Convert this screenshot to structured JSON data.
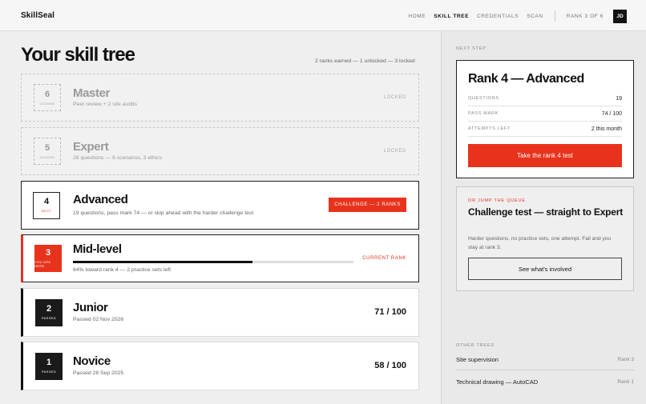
{
  "app": {
    "brand": "SkillSeal"
  },
  "nav": {
    "items": [
      {
        "label": "HOME",
        "active": false
      },
      {
        "label": "SKILL TREE",
        "active": true
      },
      {
        "label": "CREDENTIALS",
        "active": false
      },
      {
        "label": "SCAN",
        "active": false
      }
    ],
    "rank": "RANK 3 OF 6",
    "avatar": "JD"
  },
  "main": {
    "title": "Your skill tree",
    "summary": "2 ranks earned — 1 unlocked — 3 locked",
    "tiers": [
      {
        "number": "6",
        "status": "LOCKED",
        "name": "Master",
        "desc": "Peer review + 2 site audits",
        "tag": "LOCKED"
      },
      {
        "number": "5",
        "status": "LOCKED",
        "name": "Expert",
        "desc": "28 questions — 6 scenarios, 3 ethics",
        "tag": "LOCKED"
      },
      {
        "number": "4",
        "status": "NEXT",
        "name": "Advanced",
        "desc": "19 questions, pass mark 74 — or skip ahead with the harder challenge test",
        "action": "CHALLENGE — 2 RANKS"
      },
      {
        "number": "3",
        "status": "YOU ARE HERE",
        "name": "Mid-level",
        "desc": "64% toward rank 4 — 2 practice sets left",
        "tag": "CURRENT RANK",
        "progress": 0.64
      },
      {
        "number": "2",
        "status": "PASSED",
        "name": "Junior",
        "desc": "Passed 02 Nov 2026",
        "score": "71 / 100"
      },
      {
        "number": "1",
        "status": "PASSED",
        "name": "Novice",
        "desc": "Passed 28 Sep 2025",
        "score": "58 / 100"
      }
    ]
  },
  "sidebar": {
    "next_step": {
      "eyebrow": "NEXT STEP",
      "title": "Rank 4 — Advanced",
      "rows": [
        {
          "k": "QUESTIONS",
          "v": "19"
        },
        {
          "k": "PASS MARK",
          "v": "74 / 100"
        },
        {
          "k": "ATTEMPTS LEFT",
          "v": "2 this month"
        }
      ],
      "cta": "Take the rank 4 test"
    },
    "challenge": {
      "eyebrow": "OR JUMP THE QUEUE",
      "title": "Challenge test — straight to Expert",
      "text": "Harder questions, no practice sets, one attempt. Fail and you stay at rank 3.",
      "cta": "See what's involved"
    },
    "other_trees": {
      "eyebrow": "OTHER TREES",
      "items": [
        {
          "name": "Site supervision",
          "rank": "Rank 3"
        },
        {
          "name": "Technical drawing — AutoCAD",
          "rank": "Rank 1"
        }
      ]
    }
  },
  "colors": {
    "accent": "#e8331c",
    "ink": "#111111",
    "background": "#efefef"
  }
}
